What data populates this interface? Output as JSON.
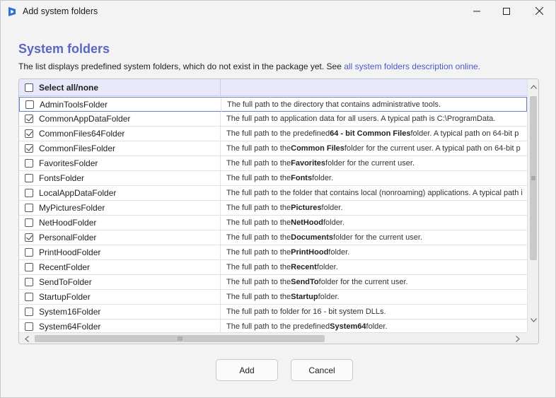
{
  "window": {
    "title": "Add system folders",
    "minimize_icon": "minimize-icon",
    "maximize_icon": "maximize-icon",
    "close_icon": "close-icon"
  },
  "heading": "System folders",
  "description": {
    "text": "The list displays predefined system folders, which do not exist in the package yet. See ",
    "link": "all system folders description online."
  },
  "grid": {
    "header": {
      "select_all_label": "Select all/none",
      "select_all_checked": false
    },
    "rows": [
      {
        "name": "AdminToolsFolder",
        "checked": false,
        "desc_pre": "The full path to the directory that contains administrative tools.",
        "desc_bold": "",
        "desc_post": ""
      },
      {
        "name": "CommonAppDataFolder",
        "checked": true,
        "desc_pre": "The full path to application data for all users. A typical path is C:\\ProgramData.",
        "desc_bold": "",
        "desc_post": ""
      },
      {
        "name": "CommonFiles64Folder",
        "checked": true,
        "desc_pre": "The full path to the predefined ",
        "desc_bold": "64 - bit Common Files",
        "desc_post": " folder. A typical path on 64-bit p"
      },
      {
        "name": "CommonFilesFolder",
        "checked": true,
        "desc_pre": "The full path to the ",
        "desc_bold": "Common Files",
        "desc_post": " folder for the current user. A typical path on 64-bit p"
      },
      {
        "name": "FavoritesFolder",
        "checked": false,
        "desc_pre": "The full path to the ",
        "desc_bold": "Favorites",
        "desc_post": " folder for the current user."
      },
      {
        "name": "FontsFolder",
        "checked": false,
        "desc_pre": "The full path to the ",
        "desc_bold": "Fonts",
        "desc_post": " folder."
      },
      {
        "name": "LocalAppDataFolder",
        "checked": false,
        "desc_pre": "The full path to the folder that contains local (nonroaming) applications. A typical path i",
        "desc_bold": "",
        "desc_post": ""
      },
      {
        "name": "MyPicturesFolder",
        "checked": false,
        "desc_pre": "The full path to the ",
        "desc_bold": "Pictures",
        "desc_post": " folder."
      },
      {
        "name": "NetHoodFolder",
        "checked": false,
        "desc_pre": "The full path to the ",
        "desc_bold": "NetHood",
        "desc_post": " folder."
      },
      {
        "name": "PersonalFolder",
        "checked": true,
        "desc_pre": "The full path to the ",
        "desc_bold": "Documents",
        "desc_post": " folder for the current user."
      },
      {
        "name": "PrintHoodFolder",
        "checked": false,
        "desc_pre": "The full path to the ",
        "desc_bold": "PrintHood",
        "desc_post": " folder."
      },
      {
        "name": "RecentFolder",
        "checked": false,
        "desc_pre": "The full path to the ",
        "desc_bold": "Recent",
        "desc_post": " folder."
      },
      {
        "name": "SendToFolder",
        "checked": false,
        "desc_pre": "The full path to the ",
        "desc_bold": "SendTo",
        "desc_post": " folder for the current user."
      },
      {
        "name": "StartupFolder",
        "checked": false,
        "desc_pre": "The full path to the ",
        "desc_bold": "Startup",
        "desc_post": " folder."
      },
      {
        "name": "System16Folder",
        "checked": false,
        "desc_pre": "The full path to folder for 16 - bit system DLLs.",
        "desc_bold": "",
        "desc_post": ""
      },
      {
        "name": "System64Folder",
        "checked": false,
        "desc_pre": "The full path to the predefined ",
        "desc_bold": "System64",
        "desc_post": " folder."
      }
    ]
  },
  "buttons": {
    "add": "Add",
    "cancel": "Cancel"
  },
  "colors": {
    "accent": "#5b67c4",
    "link": "#4b59c9",
    "header_bg": "#e7e9fb"
  }
}
